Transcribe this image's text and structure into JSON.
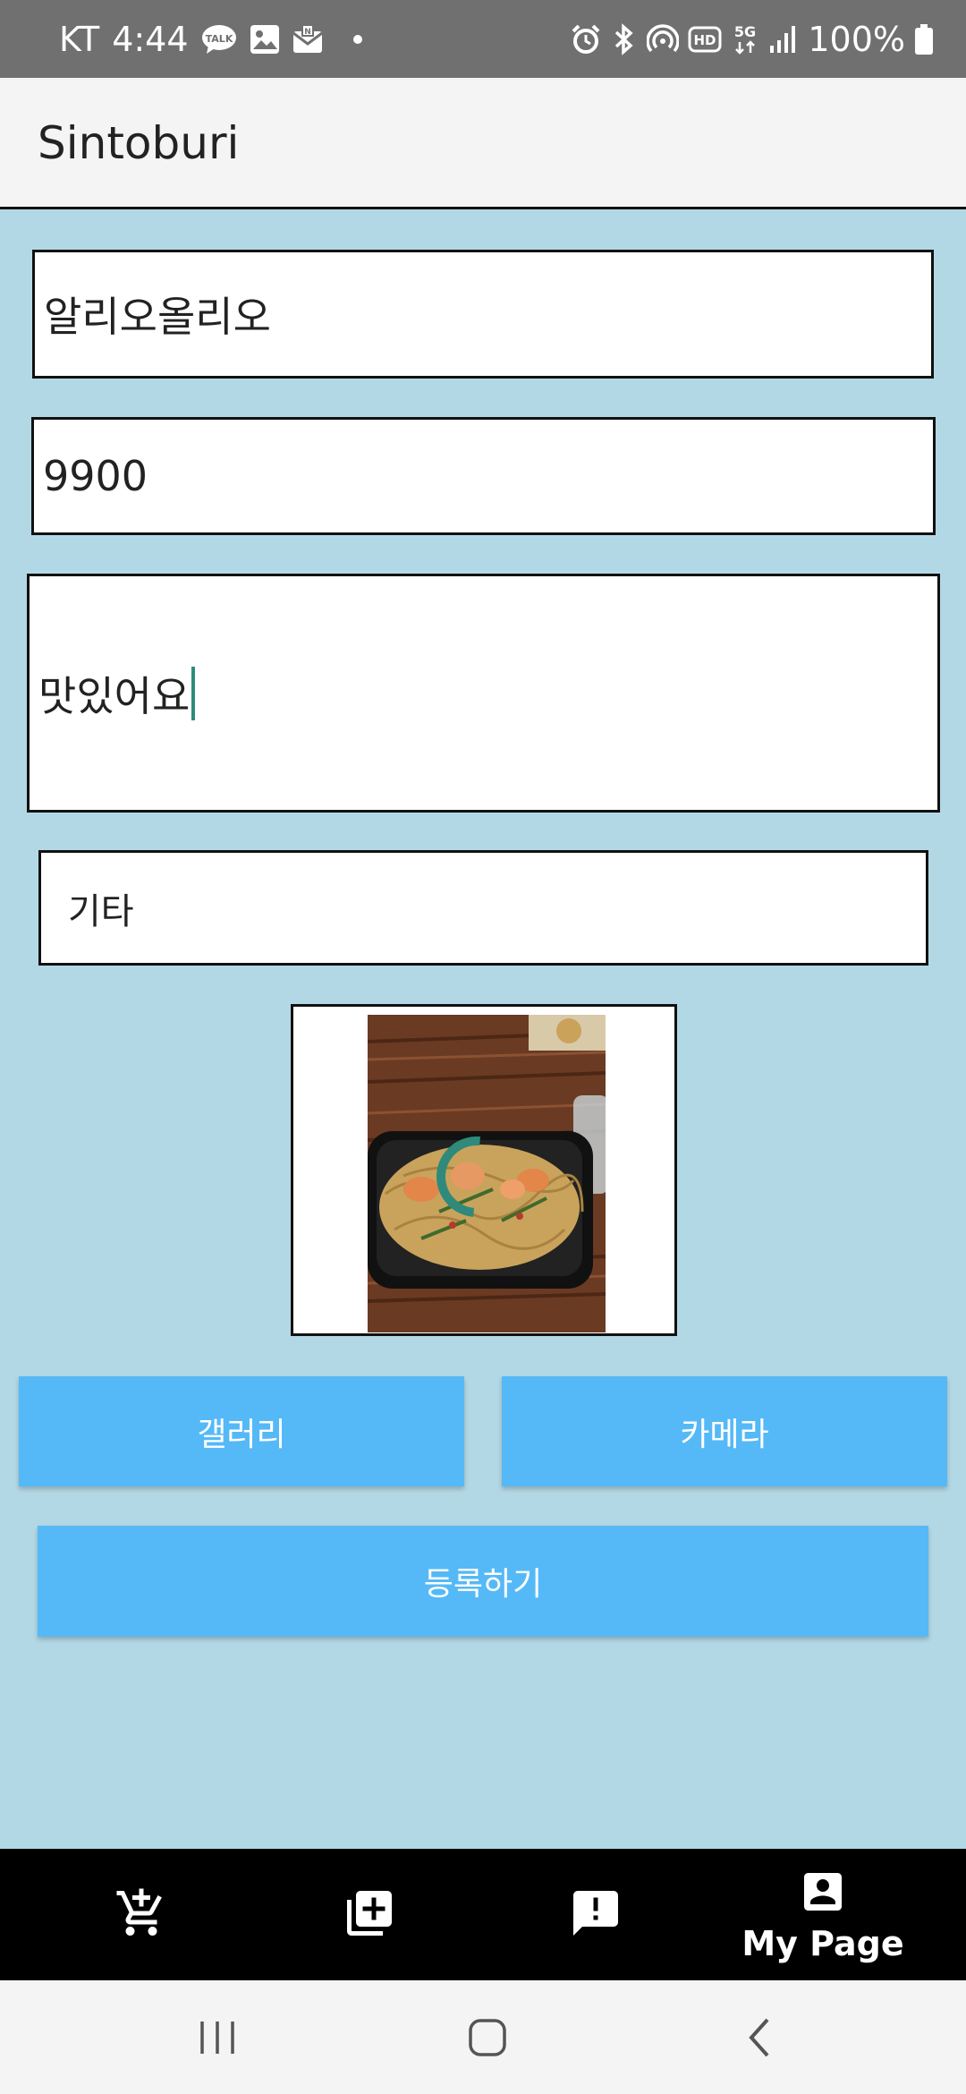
{
  "status_bar": {
    "carrier": "KT",
    "time": "4:44",
    "battery": "100%",
    "left_icons": [
      "talk-icon",
      "gallery-icon",
      "mail-icon"
    ],
    "right_icons": [
      "alarm-icon",
      "bluetooth-icon",
      "hotspot-icon",
      "hd-icon",
      "5g-icon",
      "signal-icon",
      "battery-icon"
    ]
  },
  "app_bar": {
    "title": "Sintoburi"
  },
  "form": {
    "name_value": "알리오올리오",
    "price_value": "9900",
    "description_value": "맛있어요",
    "category_value": "기타"
  },
  "buttons": {
    "gallery": "갤러리",
    "camera": "카메라",
    "register": "등록하기"
  },
  "bottom_nav": {
    "items": [
      {
        "icon": "add-cart-icon"
      },
      {
        "icon": "add-box-icon"
      },
      {
        "icon": "report-icon"
      },
      {
        "icon": "account-box-icon",
        "label": "My Page"
      }
    ]
  },
  "colors": {
    "background": "#b3d8e5",
    "button": "#55b9f7",
    "accent": "#2f8a7c",
    "status_bar": "#707070"
  }
}
